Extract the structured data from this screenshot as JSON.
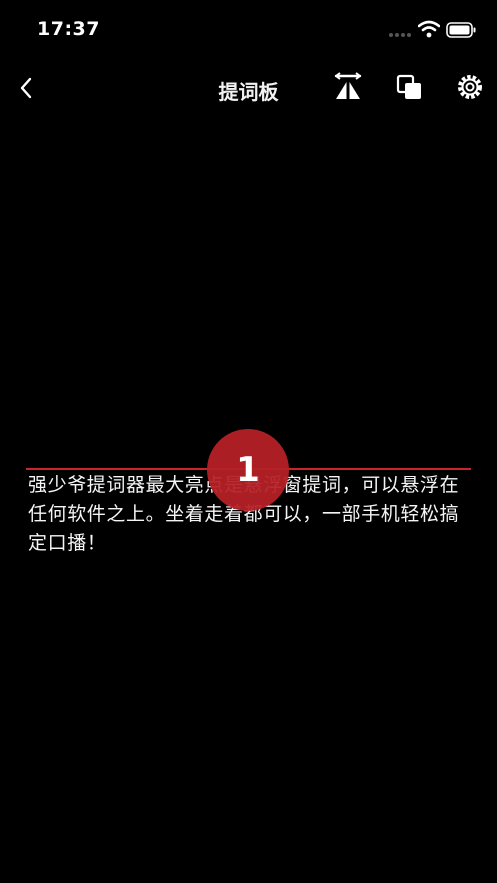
{
  "status_bar": {
    "time": "17:37"
  },
  "nav": {
    "title": "提词板",
    "back_icon": "chevron-left-icon",
    "mirror_icon": "mirror-flip-icon",
    "copy_icon": "copy-icon",
    "settings_icon": "gear-icon"
  },
  "teleprompter": {
    "countdown": "1",
    "text": "强少爷提词器最大亮点是悬浮窗提词，可以悬浮在任何软件之上。坐着走着都可以，一部手机轻松搞定口播！",
    "accent_color": "#c9242b"
  }
}
